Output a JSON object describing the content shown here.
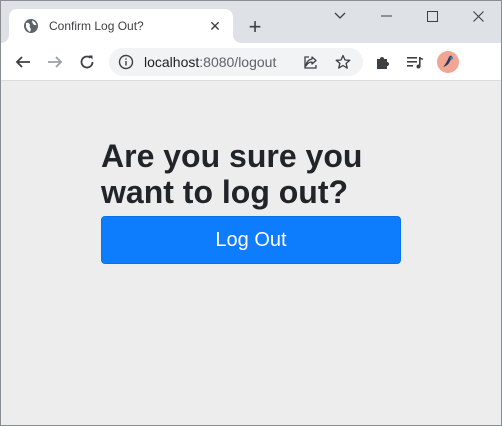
{
  "browser": {
    "tab": {
      "title": "Confirm Log Out?",
      "favicon": "globe-icon",
      "close_glyph": "✕"
    },
    "new_tab_glyph": "+",
    "window_controls": [
      "chevron-down-icon",
      "minimize-icon",
      "maximize-icon",
      "close-icon"
    ],
    "toolbar": {
      "back": "back-arrow-icon",
      "forward": "forward-arrow-icon",
      "reload": "reload-icon",
      "url_host": "localhost",
      "url_path": ":8080/logout",
      "omnibox_icons": [
        "info-icon",
        "share-icon",
        "star-icon"
      ],
      "extensions": [
        "puzzle-icon",
        "media-playlist-icon"
      ],
      "profile": "avatar"
    }
  },
  "page": {
    "heading": "Are you sure you want to log out?",
    "logout_button": "Log Out",
    "colors": {
      "background": "#ededed",
      "button": "#0d7dfd",
      "button_text": "#ffffff",
      "heading": "#212529"
    }
  }
}
